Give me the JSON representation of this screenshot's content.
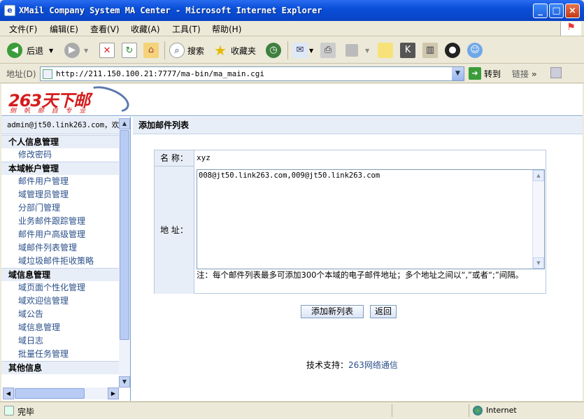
{
  "window": {
    "title": "XMail Company System MA Center - Microsoft Internet Explorer"
  },
  "menu": [
    "文件(F)",
    "编辑(E)",
    "查看(V)",
    "收藏(A)",
    "工具(T)",
    "帮助(H)"
  ],
  "toolbar": {
    "back": "后退",
    "search": "搜索",
    "favorites": "收藏夹"
  },
  "address": {
    "label": "地址(D)",
    "url": "http://211.150.100.21:7777/ma-bin/ma_main.cgi",
    "go": "转到",
    "links": "链接"
  },
  "logo": {
    "text": "263天下邮",
    "slogan": "倒 帆 邮 自 专 业"
  },
  "sidebar": {
    "user": "admin@jt50.link263.com，欢",
    "sections": [
      {
        "title": "个人信息管理",
        "items": [
          "修改密码"
        ]
      },
      {
        "title": "本域帐户管理",
        "items": [
          "邮件用户管理",
          "域管理员管理",
          "分部门管理",
          "业务邮件跟踪管理",
          "邮件用户高级管理",
          "域邮件列表管理",
          "域垃圾邮件拒收策略"
        ]
      },
      {
        "title": "域信息管理",
        "items": [
          "域页面个性化管理",
          "域欢迎信管理",
          "域公告",
          "域信息管理",
          "域日志",
          "批量任务管理"
        ]
      },
      {
        "title": "其他信息",
        "items": []
      }
    ]
  },
  "main": {
    "heading": "添加邮件列表",
    "name_label": "名 称：",
    "name_value": "xyz",
    "addr_label": "地 址：",
    "addr_value": "008@jt50.link263.com,009@jt50.link263.com",
    "note": "注：每个邮件列表最多可添加300个本域的电子邮件地址；多个地址之间以“,”或者“;”间隔。",
    "btn_add": "添加新列表",
    "btn_back": "返回",
    "support_label": "技术支持：",
    "support_link": "263网络通信"
  },
  "status": {
    "text": "完毕",
    "zone": "Internet"
  }
}
